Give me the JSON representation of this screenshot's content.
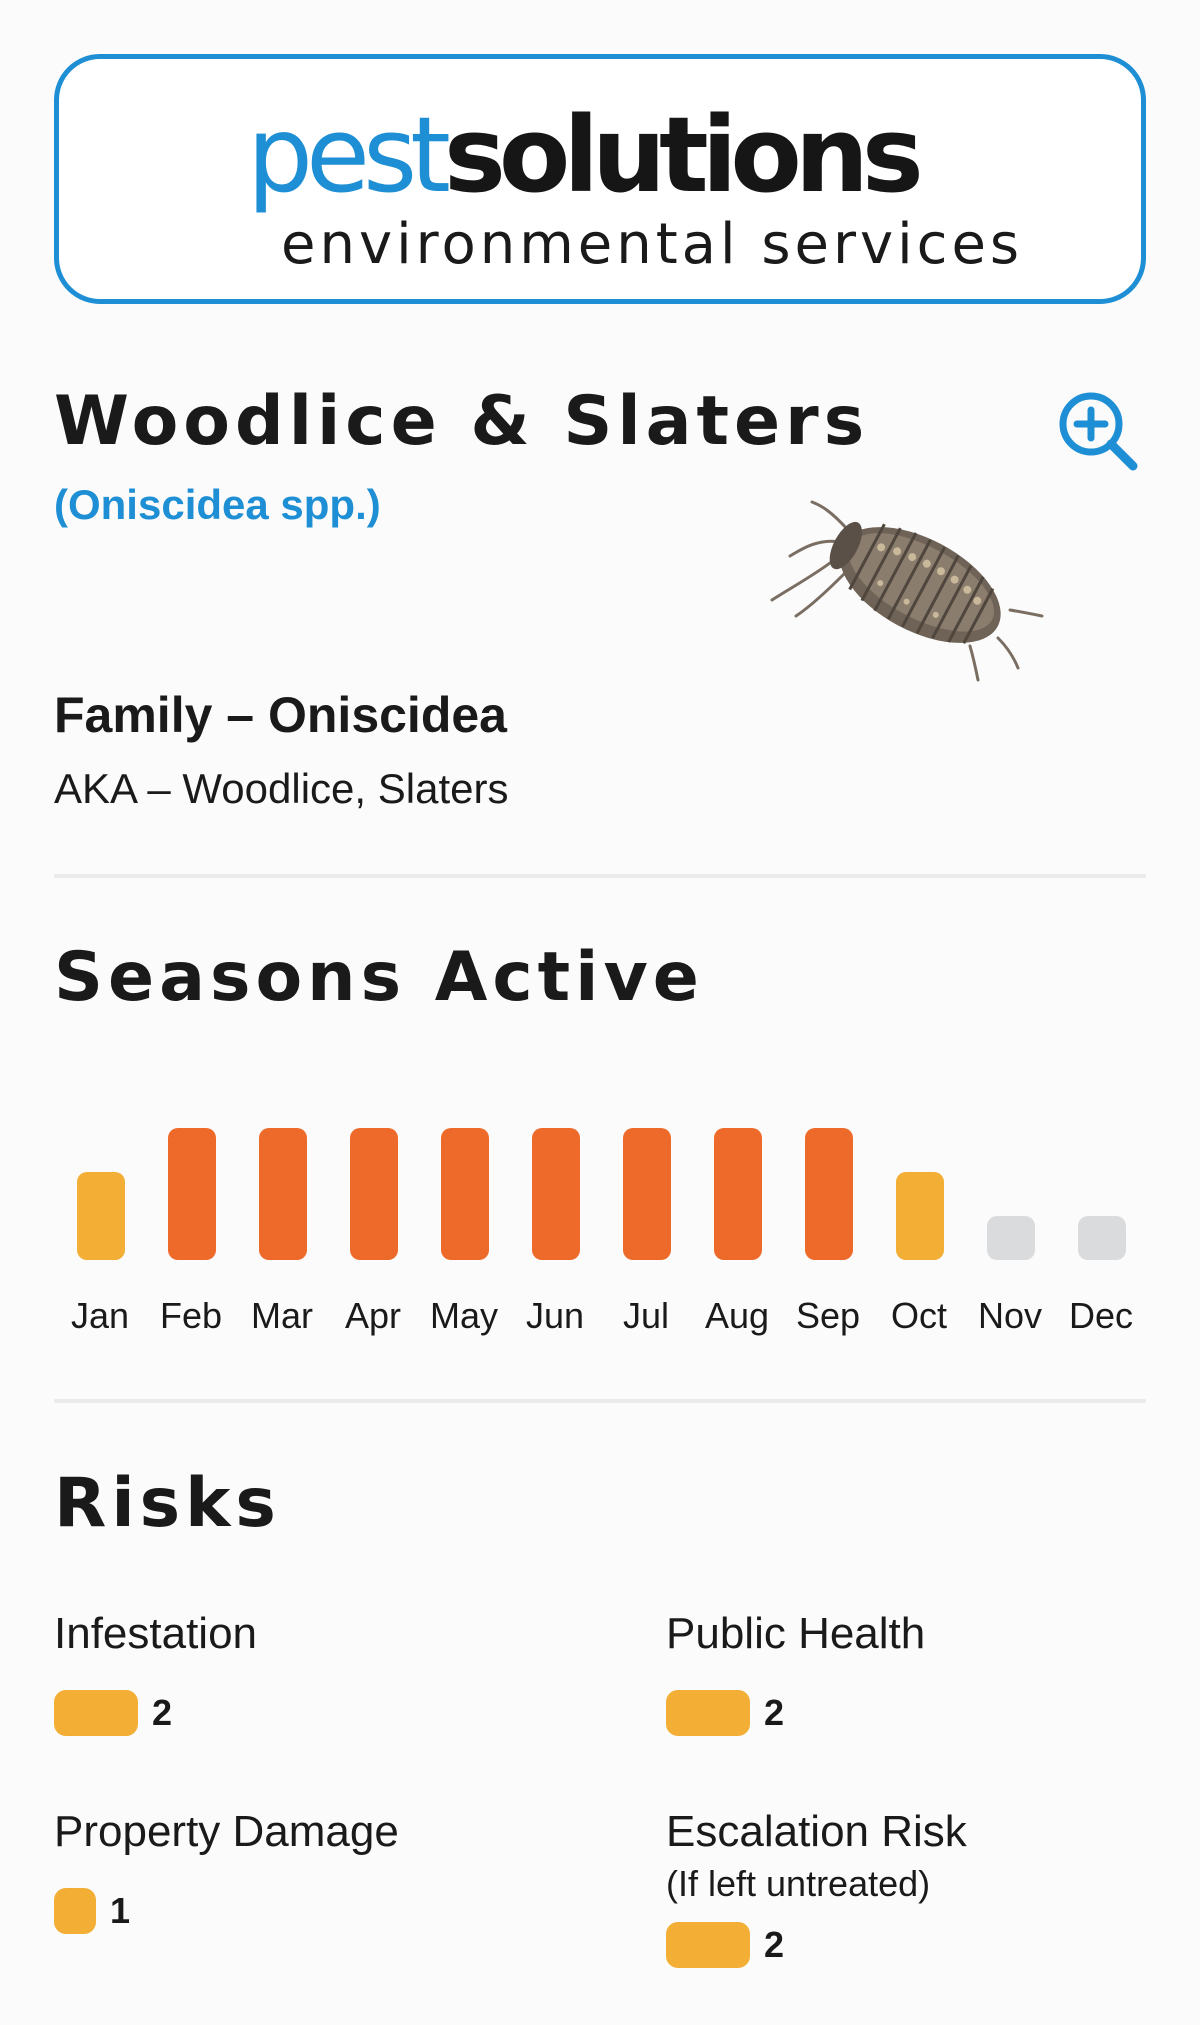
{
  "brand": {
    "name_part1": "pest",
    "name_part2": "solutions",
    "tagline": "environmental services",
    "colors": {
      "blue": "#1e8fd4",
      "dark": "#161616"
    }
  },
  "pest": {
    "title": "Woodlice & Slaters",
    "scientific": "(Oniscidea spp.)",
    "family": "Family – Oniscidea",
    "aka": "AKA – Woodlice, Slaters",
    "zoom_icon": "zoom-in-icon"
  },
  "seasons": {
    "title": "Seasons Active",
    "level_colors": {
      "0": "#d9dbdd",
      "1": "#f2ae35",
      "2": "#ee6a2a"
    },
    "months": [
      {
        "label": "Jan",
        "level": 1
      },
      {
        "label": "Feb",
        "level": 2
      },
      {
        "label": "Mar",
        "level": 2
      },
      {
        "label": "Apr",
        "level": 2
      },
      {
        "label": "May",
        "level": 2
      },
      {
        "label": "Jun",
        "level": 2
      },
      {
        "label": "Jul",
        "level": 2
      },
      {
        "label": "Aug",
        "level": 2
      },
      {
        "label": "Sep",
        "level": 2
      },
      {
        "label": "Oct",
        "level": 1
      },
      {
        "label": "Nov",
        "level": 0
      },
      {
        "label": "Dec",
        "level": 0
      }
    ]
  },
  "risks": {
    "title": "Risks",
    "bar_color": "#f2ae35",
    "items": [
      {
        "label": "Infestation",
        "note": "",
        "value": "2"
      },
      {
        "label": "Public Health",
        "note": "",
        "value": "2"
      },
      {
        "label": "Property Damage",
        "note": "",
        "value": "1"
      },
      {
        "label": "Escalation Risk",
        "note": "(If left untreated)",
        "value": "2"
      }
    ]
  }
}
